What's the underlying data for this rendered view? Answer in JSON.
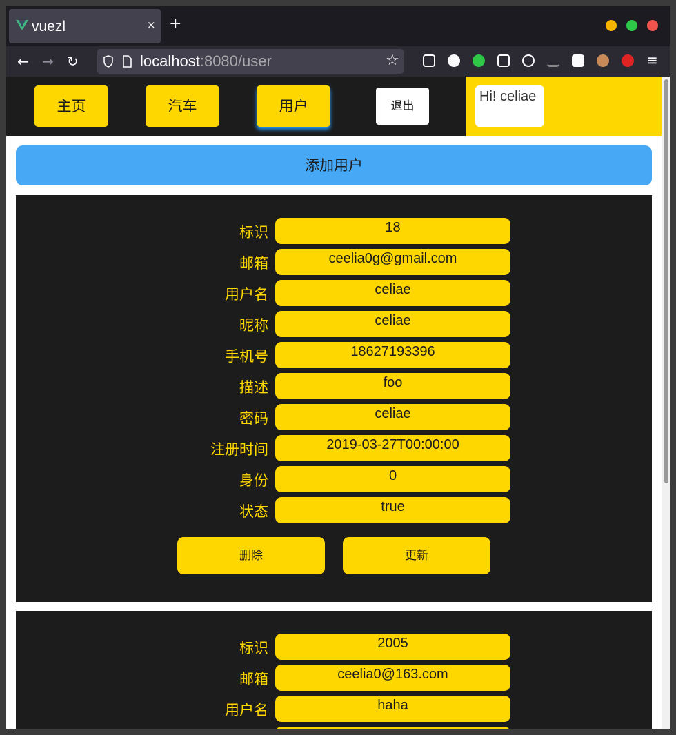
{
  "browser": {
    "tab_title": "vuezl",
    "tab_close": "×",
    "new_tab": "+",
    "url_host": "localhost",
    "url_path": ":8080/user",
    "colors": {
      "traffic_yellow": "#f5b400",
      "traffic_green": "#2ec748",
      "traffic_red": "#f0534d"
    },
    "nav_icons": [
      "back-icon",
      "forward-icon",
      "reload-icon"
    ],
    "extensions": [
      "pocket-icon",
      "grammarly-icon",
      "cat-extension-icon",
      "reader-icon",
      "react-devtools-icon",
      "graph-extension-icon",
      "face-extension-icon",
      "owl-extension-icon",
      "adblock-icon",
      "menu-icon"
    ]
  },
  "header": {
    "nav": [
      "主页",
      "汽车",
      "用户"
    ],
    "active_index": 2,
    "logout": "退出",
    "greeting": "Hi! celiae"
  },
  "add_user": "添加用户",
  "fields": [
    "标识",
    "邮箱",
    "用户名",
    "昵称",
    "手机号",
    "描述",
    "密码",
    "注册时间",
    "身份",
    "状态"
  ],
  "users": [
    {
      "values": [
        "18",
        "ceelia0g@gmail.com",
        "celiae",
        "celiae",
        "18627193396",
        "foo",
        "celiae",
        "2019-03-27T00:00:00",
        "0",
        "true"
      ],
      "delete": "删除",
      "update": "更新"
    },
    {
      "values": [
        "2005",
        "ceelia0@163.com",
        "haha"
      ]
    }
  ],
  "colors": {
    "accent": "#ffd700",
    "card_bg": "#1c1c1c",
    "add_button": "#47a8f5",
    "active_glow": "#2196f3"
  }
}
